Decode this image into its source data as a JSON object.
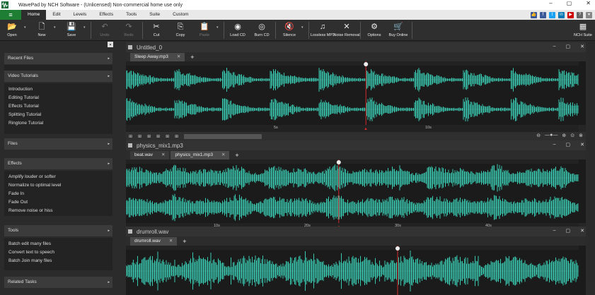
{
  "window": {
    "title": "WavePad by NCH Software - (Unlicensed) Non-commercial home use only",
    "controls": [
      "–",
      "▢",
      "✕"
    ]
  },
  "menu": {
    "items": [
      "Home",
      "Edit",
      "Levels",
      "Effects",
      "Tools",
      "Suite",
      "Custom"
    ],
    "active": "Home"
  },
  "toolbar": {
    "buttons": [
      {
        "label": "Open",
        "icon": "open-folder-icon",
        "glyph": "📂",
        "enabled": true,
        "dropdown": true
      },
      {
        "label": "New",
        "icon": "new-file-icon",
        "glyph": "🗋",
        "enabled": true,
        "dropdown": true
      },
      {
        "label": "Save",
        "icon": "save-icon",
        "glyph": "💾",
        "enabled": true,
        "dropdown": true
      },
      {
        "label": "Undo",
        "icon": "undo-icon",
        "glyph": "↶",
        "enabled": false
      },
      {
        "label": "Redo",
        "icon": "redo-icon",
        "glyph": "↷",
        "enabled": false
      },
      {
        "label": "Cut",
        "icon": "scissors-icon",
        "glyph": "✂",
        "enabled": true
      },
      {
        "label": "Copy",
        "icon": "copy-icon",
        "glyph": "⎘",
        "enabled": true
      },
      {
        "label": "Paste",
        "icon": "paste-icon",
        "glyph": "📋",
        "enabled": false,
        "dropdown": true
      },
      {
        "label": "Load CD",
        "icon": "cd-load-icon",
        "glyph": "◉",
        "enabled": true
      },
      {
        "label": "Burn CD",
        "icon": "cd-burn-icon",
        "glyph": "◎",
        "enabled": true
      },
      {
        "label": "Silence",
        "icon": "silence-icon",
        "glyph": "🔇",
        "enabled": true,
        "dropdown": true
      },
      {
        "label": "Lossless MP3",
        "icon": "lossless-mp3-icon",
        "glyph": "♫",
        "enabled": true
      },
      {
        "label": "Noise Removal",
        "icon": "noise-removal-icon",
        "glyph": "✕",
        "enabled": true
      },
      {
        "label": "Options",
        "icon": "options-icon",
        "glyph": "⚙",
        "enabled": true
      },
      {
        "label": "Buy Online",
        "icon": "cart-icon",
        "glyph": "🛒",
        "enabled": true
      }
    ],
    "suite_label": "NCH Suite"
  },
  "sidebar": {
    "sections": [
      {
        "title": "Recent Files",
        "items": []
      },
      {
        "title": "Video Tutorials",
        "items": [
          "Introduction",
          "Editing Tutorial",
          "Effects Tutorial",
          "Splitting Tutorial",
          "Ringtone Tutorial"
        ]
      },
      {
        "title": "Files",
        "items": []
      },
      {
        "title": "Effects",
        "items": [
          "Amplify louder or softer",
          "Normalize to optimal level",
          "Fade In",
          "Fade Out",
          "Remove noise or hiss"
        ]
      },
      {
        "title": "Tools",
        "items": [
          "Batch edit many files",
          "Convert text to speech",
          "Batch Join many files"
        ]
      },
      {
        "title": "Related Tasks",
        "items": []
      }
    ]
  },
  "panels": [
    {
      "title": "Untitled_0",
      "tabs": [
        {
          "label": "Sleep Away.mp3",
          "active": true
        }
      ],
      "ruler_labels": [
        "5s",
        "10s"
      ],
      "cursor_position": 0.53,
      "channels": 2
    },
    {
      "title": "physics_mix1.mp3",
      "tabs": [
        {
          "label": "beat.wav",
          "active": false
        },
        {
          "label": "physics_mix1.mp3",
          "active": true
        }
      ],
      "ruler_labels": [
        "10s",
        "20s",
        "30s",
        "40s"
      ],
      "cursor_position": 0.47,
      "channels": 2
    },
    {
      "title": "drumroll.wav",
      "tabs": [
        {
          "label": "drumroll.wav",
          "active": true
        }
      ],
      "ruler_labels": [],
      "cursor_position": 0.6,
      "channels": 1
    }
  ],
  "colors": {
    "wave": "#39c9b0",
    "cursor": "#d62c2c",
    "background": "#1b1b1b"
  }
}
